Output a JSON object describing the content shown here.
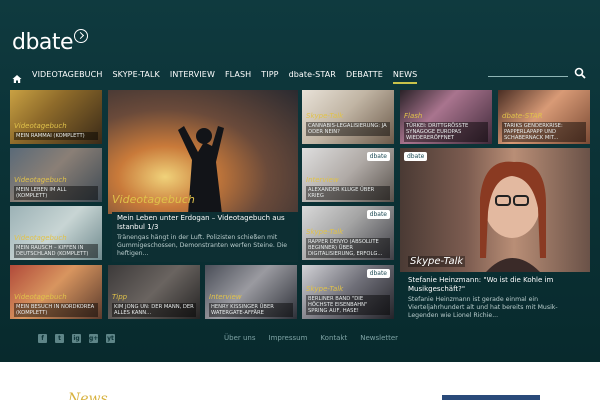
{
  "logo": {
    "text": "dbate"
  },
  "nav": {
    "items": [
      {
        "label": "VIDEOTAGEBUCH"
      },
      {
        "label": "SKYPE-TALK"
      },
      {
        "label": "INTERVIEW"
      },
      {
        "label": "FLASH"
      },
      {
        "label": "TIPP"
      },
      {
        "label": "dbate-STAR"
      },
      {
        "label": "DEBATTE"
      },
      {
        "label": "NEWS",
        "active": true
      }
    ],
    "search_placeholder": ""
  },
  "tiles": {
    "t1": {
      "cat": "Videotagebuch",
      "cap": "MEIN RAMMAI (KOMPLETT)"
    },
    "t2": {
      "cat": "Videotagebuch",
      "cap": "MEIN LEBEN IM ALL (KOMPLETT)"
    },
    "t3": {
      "cat": "Videotagebuch",
      "cap": "MEIN RAUSCH – KIFFEN IN DEUTSCHLAND (KOMPLETT)"
    },
    "t4": {
      "cat": "Videotagebuch",
      "cap": "MEIN BESUCH IN NORDKOREA (KOMPLETT)"
    },
    "t5": {
      "cat": "Tipp",
      "cap": "KIM JONG UN: DER MANN, DER ALLES KANN..."
    },
    "t6": {
      "cat": "Interview",
      "cap": "HENRY KISSINGER ÜBER WATERGATE-AFFÄRE"
    },
    "t7": {
      "cat": "Skype-Talk",
      "cap": "CANNABIS-LEGALISIERUNG: JA ODER NEIN?"
    },
    "t8": {
      "cat": "Interview",
      "cap": "ALEXANDER KLUGE ÜBER KRIEG"
    },
    "t9": {
      "cat": "Skype-Talk",
      "cap": "RAPPER DENYO (ABSOLUTE BEGINNER) ÜBER DIGITALISIERUNG, ERFOLG..."
    },
    "t10": {
      "cat": "Skype-Talk",
      "cap": "BERLINER BAND \"DIE HÖCHSTE EISENBAHN\" SPRING AUF, HASE!"
    },
    "t11": {
      "cat": "Flash",
      "cap": "TÜRKEI: DRITTGRÖSSTE SYNAGOGE EUROPAS WIEDERERÖFFNET"
    },
    "t12": {
      "cat": "dbate-STAR",
      "cap": "TARIKS GENDERKRISE: PAPPERLAPAPP UND SCHABERNACK MIT..."
    }
  },
  "feature_left": {
    "cat": "Videotagebuch",
    "title": "Mein Leben unter Erdogan – Videotagebuch aus Istanbul 1/3",
    "desc": "Tränengas hängt in der Luft. Polizisten schießen mit Gummigeschossen, Demonstranten werfen Steine. Die heftigen..."
  },
  "feature_right": {
    "badge": "dbate",
    "cat": "Skype-Talk",
    "title": "Stefanie Heinzmann: \"Wo ist die Kohle im Musikgeschäft?\"",
    "desc": "Stefanie Heinzmann ist gerade einmal ein Vierteljahrhundert alt und hat bereits mit Musik-Legenden wie Lionel Richie..."
  },
  "badges": {
    "dbate": "dbate"
  },
  "social": [
    "f",
    "t",
    "ig",
    "g+",
    "yt"
  ],
  "footer_links": [
    "Über uns",
    "Impressum",
    "Kontakt",
    "Newsletter"
  ],
  "news_heading": "News",
  "colors": {
    "bg": "#0b3236",
    "accent": "#c9c24a",
    "category": "#e0c24a"
  }
}
